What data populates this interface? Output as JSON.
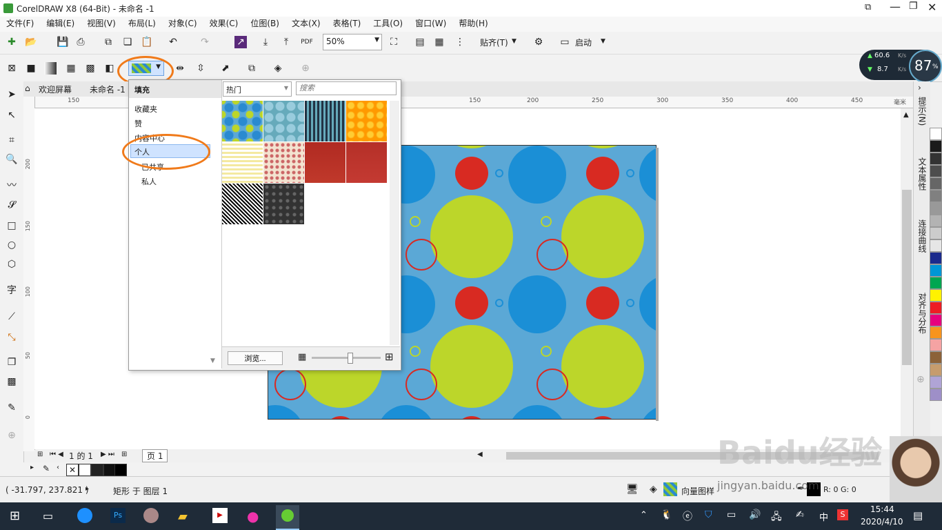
{
  "app": {
    "title": "CorelDRAW X8 (64-Bit) - 未命名 -1",
    "window_controls": [
      "restore",
      "minimize",
      "maximize",
      "close"
    ]
  },
  "menu": [
    "文件(F)",
    "编辑(E)",
    "视图(V)",
    "布局(L)",
    "对象(C)",
    "效果(C)",
    "位图(B)",
    "文本(X)",
    "表格(T)",
    "工具(O)",
    "窗口(W)",
    "帮助(H)"
  ],
  "toolbar": {
    "zoom_value": "50%",
    "snap_label": "贴齐(T)",
    "launch_label": "启动"
  },
  "perf_widget": {
    "upload": "60.6",
    "upload_unit": "K/s",
    "download": "8.7",
    "download_unit": "K/s",
    "percent": "87",
    "percent_unit": "%"
  },
  "doc_tabs": {
    "welcome": "欢迎屏幕",
    "current": "未命名 -1"
  },
  "ruler": {
    "h_ticks": [
      "150",
      "150",
      "200",
      "250",
      "300",
      "350",
      "400",
      "450"
    ],
    "unit": "毫米",
    "v_ticks": [
      "200",
      "150",
      "100",
      "50",
      "0"
    ]
  },
  "fill_popup": {
    "header": "填充",
    "category_select": "热门",
    "search_placeholder": "搜索",
    "tree": [
      "收藏夹",
      "赞",
      "内容中心",
      "个人",
      "已共享",
      "私人"
    ],
    "browse_button": "浏览...",
    "size_slider": 0.55
  },
  "right_docker": {
    "tabs": [
      "提示(N)",
      "文本属性",
      "连接曲线",
      "对齐与分布"
    ]
  },
  "palette_colors": [
    "#ffffff",
    "#1a1a1a",
    "#333333",
    "#4d4d4d",
    "#666666",
    "#808080",
    "#999999",
    "#b3b3b3",
    "#cccccc",
    "#e6e6e6",
    "#1b2a8c",
    "#0096d6",
    "#00a651",
    "#fff200",
    "#ed1c24",
    "#e6007e",
    "#f7941d",
    "#f5a3a3",
    "#8c6239",
    "#c69c6d",
    "#b0a4d6",
    "#9e8fc8"
  ],
  "page_nav": {
    "page_label": "1 的 1",
    "page_tab": "页 1"
  },
  "status": {
    "coords": "( -31.797, 237.821 )",
    "object_info": "矩形 于 图层 1",
    "fill_type": "向量图样",
    "outline_color": "R: 0 G: 0"
  },
  "watermark": {
    "brand": "Baidu经验",
    "url": "jingyan.baidu.com"
  },
  "taskbar": {
    "time": "15:44",
    "date": "2020/4/10",
    "ime": "中"
  }
}
